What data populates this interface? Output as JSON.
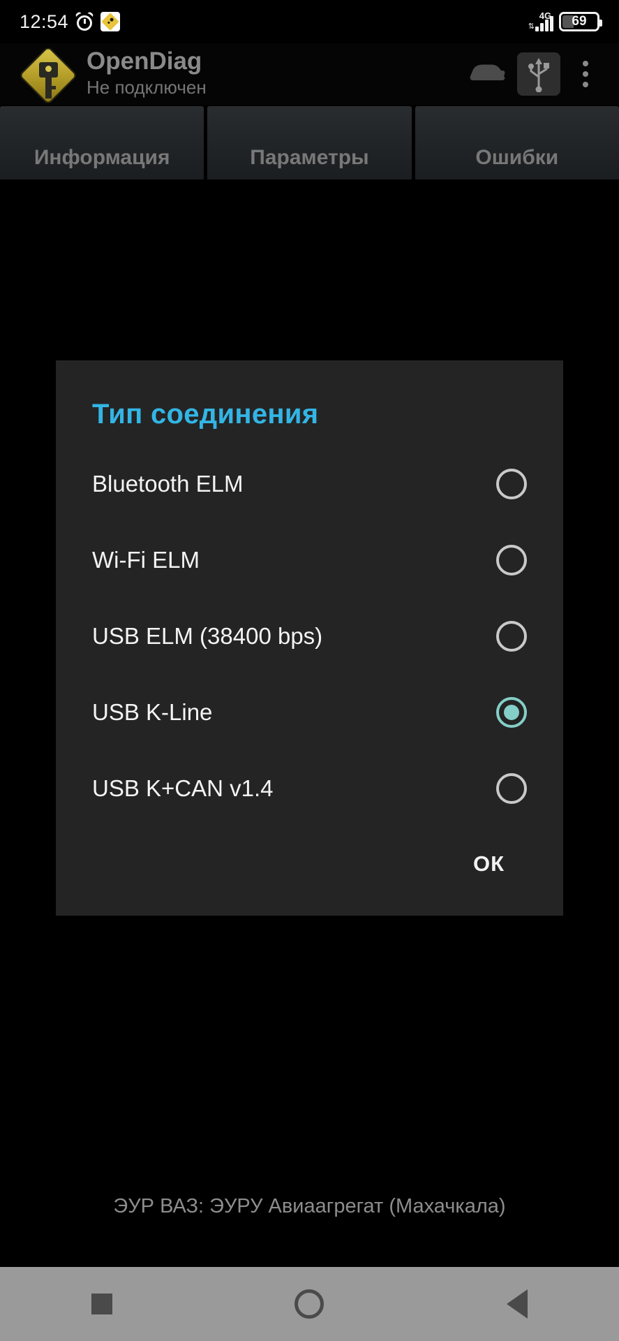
{
  "status_bar": {
    "clock": "12:54",
    "alarm_icon": "alarm-clock-icon",
    "notification_icon": "opendiag-notification-icon",
    "network_type": "4G",
    "data_arrows": "⇅",
    "signal_icon": "signal-bars-icon",
    "battery_percent": "69"
  },
  "app_bar": {
    "logo_icon": "opendiag-logo-icon",
    "title": "OpenDiag",
    "subtitle": "Не подключен",
    "car_icon": "car-icon",
    "usb_icon": "usb-icon",
    "overflow_icon": "overflow-menu-icon"
  },
  "tabs": [
    {
      "label": "Информация",
      "name": "tab-information"
    },
    {
      "label": "Параметры",
      "name": "tab-parameters"
    },
    {
      "label": "Ошибки",
      "name": "tab-errors"
    }
  ],
  "dialog": {
    "title": "Тип соединения",
    "title_color": "#33b5e5",
    "selected_color": "#84cfc8",
    "options": [
      {
        "label": "Bluetooth ELM",
        "checked": false
      },
      {
        "label": "Wi-Fi ELM",
        "checked": false
      },
      {
        "label": "USB ELM (38400 bps)",
        "checked": false
      },
      {
        "label": "USB K-Line",
        "checked": true
      },
      {
        "label": "USB K+CAN v1.4",
        "checked": false
      }
    ],
    "ok_label": "ОК"
  },
  "bottom_status": {
    "text": "ЭУР ВАЗ: ЭУРУ Авиаагрегат (Махачкала)"
  },
  "nav_bar": {
    "recents_icon": "square-recents-icon",
    "home_icon": "circle-home-icon",
    "back_icon": "triangle-back-icon"
  }
}
